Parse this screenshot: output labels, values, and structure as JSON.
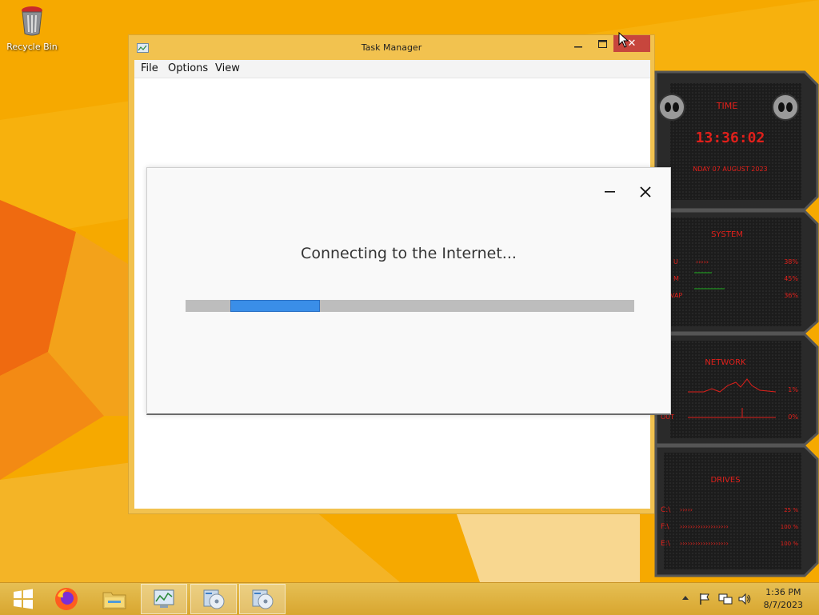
{
  "desktop": {
    "icons": [
      {
        "label": "Recycle Bin",
        "icon": "recycle-bin-icon"
      }
    ]
  },
  "task_manager": {
    "title": "Task Manager",
    "menu": [
      "File",
      "Options",
      "View"
    ]
  },
  "dialog": {
    "message": "Connecting to the Internet...",
    "progress": 0.2
  },
  "gadgets": {
    "time": {
      "header": "TIME",
      "clock": "13:36:02",
      "date": "NDAY 07 AUGUST 2023"
    },
    "system": {
      "header": "SYSTEM",
      "rows": [
        {
          "label": "U",
          "value": "38%"
        },
        {
          "label": "M",
          "value": "45%"
        },
        {
          "label": "VAP",
          "value": "36%"
        }
      ]
    },
    "network": {
      "header": "NETWORK",
      "rows": [
        {
          "label": "",
          "value": "1%"
        },
        {
          "label": "OUT",
          "value": "0%"
        }
      ]
    },
    "drives": {
      "header": "DRIVES",
      "rows": [
        {
          "label": "C:\\",
          "value": "25 %"
        },
        {
          "label": "F:\\",
          "value": "100 %"
        },
        {
          "label": "E:\\",
          "value": "100 %"
        }
      ]
    }
  },
  "taskbar": {
    "items": [
      {
        "name": "start-button",
        "icon": "windows-logo-icon"
      },
      {
        "name": "firefox",
        "icon": "firefox-icon"
      },
      {
        "name": "file-explorer",
        "icon": "folder-icon"
      },
      {
        "name": "task-manager",
        "icon": "task-manager-icon"
      },
      {
        "name": "setup-1",
        "icon": "installer-disc-icon"
      },
      {
        "name": "setup-2",
        "icon": "installer-disc-icon"
      }
    ],
    "time": "1:36 PM",
    "date": "8/7/2023"
  },
  "colors": {
    "wallpaper": "#f5a800",
    "window_frame": "#f2c24f",
    "close_button": "#c7463d",
    "progress": "#3a8ee8",
    "gadget_red": "#e0201b"
  }
}
